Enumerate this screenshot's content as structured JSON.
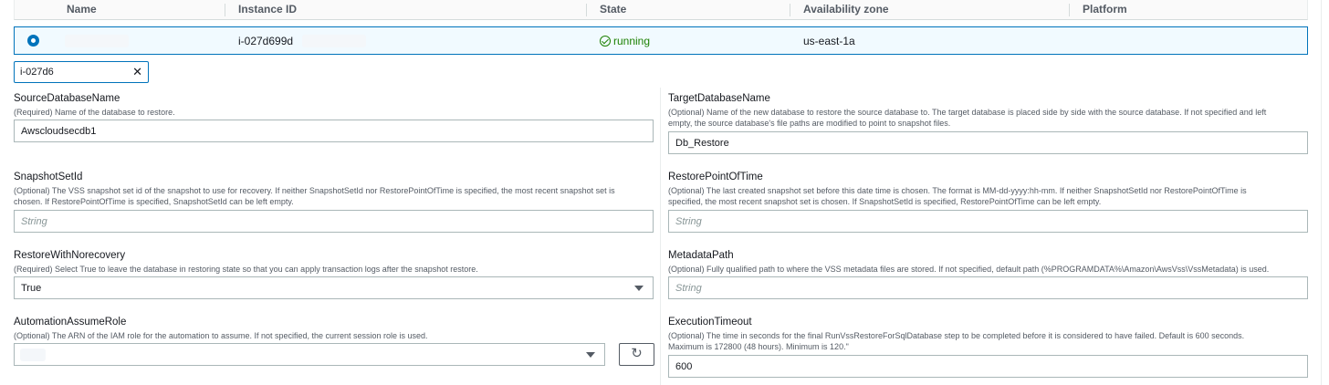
{
  "table": {
    "columns": [
      "Name",
      "Instance ID",
      "State",
      "Availability zone",
      "Platform"
    ],
    "row": {
      "instance_id": "i-027d699d",
      "state": "running",
      "availability_zone": "us-east-1a"
    }
  },
  "filter": {
    "value": "i-027d6",
    "clear_icon": "close-icon"
  },
  "fields": {
    "source_db": {
      "label": "SourceDatabaseName",
      "description": "(Required) Name of the database to restore.",
      "value": "Awscloudsecdb1"
    },
    "target_db": {
      "label": "TargetDatabaseName",
      "description_1": "(Optional) Name of the new database to restore the source database to. The target database is placed side by side with the source database. If not specified and left",
      "description_2": "empty, the source database's file paths are modified to point to snapshot files.",
      "value": "Db_Restore"
    },
    "snapshot_set_id": {
      "label": "SnapshotSetId",
      "description_1": "(Optional) The VSS snapshot set id of the snapshot to use for recovery. If neither SnapshotSetId nor RestorePointOfTime is specified, the most recent snapshot set is",
      "description_2": "chosen. If RestorePointOfTime is specified, SnapshotSetId can be left empty.",
      "placeholder": "String"
    },
    "restore_point": {
      "label": "RestorePointOfTime",
      "description_1": "(Optional) The last created snapshot set before this date time is chosen. The format is MM-dd-yyyy:hh-mm. If neither SnapshotSetId nor RestorePointOfTime is",
      "description_2": "specified, the most recent snapshot set is chosen. If SnapshotSetId is specified, RestorePointOfTime can be left empty.",
      "placeholder": "String"
    },
    "norecovery": {
      "label": "RestoreWithNorecovery",
      "description": "(Required) Select True to leave the database in restoring state so that you can apply transaction logs after the snapshot restore.",
      "value": "True"
    },
    "metadata_path": {
      "label": "MetadataPath",
      "description": "(Optional) Fully qualified path to where the VSS metadata files are stored. If not specified, default path (%PROGRAMDATA%\\Amazon\\AwsVss\\VssMetadata) is used.",
      "placeholder": "String"
    },
    "assume_role": {
      "label": "AutomationAssumeRole",
      "description": "(Optional) The ARN of the IAM role for the automation to assume. If not specified, the current session role is used.",
      "refresh_icon": "refresh-icon"
    },
    "timeout": {
      "label": "ExecutionTimeout",
      "description_1": "(Optional) The time in seconds for the final RunVssRestoreForSqlDatabase step to be completed before it is considered to have failed. Default is 600 seconds.",
      "description_2": "Maximum is 172800 (48 hours). Minimum is 120.\"",
      "value": "600"
    }
  }
}
